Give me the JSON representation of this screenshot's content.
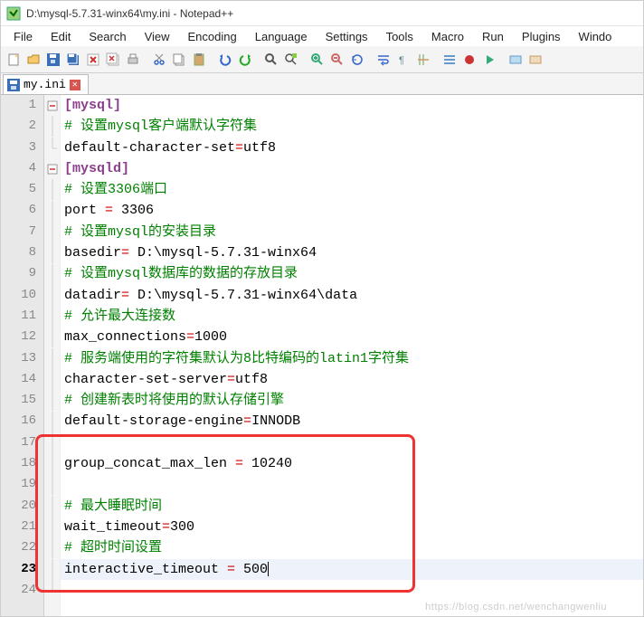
{
  "window": {
    "title": "D:\\mysql-5.7.31-winx64\\my.ini - Notepad++",
    "app": "Notepad++"
  },
  "menu": [
    "File",
    "Edit",
    "Search",
    "View",
    "Encoding",
    "Language",
    "Settings",
    "Tools",
    "Macro",
    "Run",
    "Plugins",
    "Windo"
  ],
  "tab": {
    "label": "my.ini"
  },
  "editor": {
    "active_line": 23,
    "lines": [
      {
        "n": 1,
        "fold": "minus",
        "seg": [
          {
            "c": "sect",
            "t": "[mysql]"
          }
        ]
      },
      {
        "n": 2,
        "fold": "pipe",
        "seg": [
          {
            "c": "cmt",
            "t": "# 设置mysql客户端默认字符集"
          }
        ]
      },
      {
        "n": 3,
        "fold": "end",
        "seg": [
          {
            "c": "kw",
            "t": "default-character-set"
          },
          {
            "c": "eq",
            "t": "="
          },
          {
            "c": "val",
            "t": "utf8"
          }
        ]
      },
      {
        "n": 4,
        "fold": "minus",
        "seg": [
          {
            "c": "sect",
            "t": "[mysqld]"
          }
        ]
      },
      {
        "n": 5,
        "fold": "pipe",
        "seg": [
          {
            "c": "cmt",
            "t": "# 设置3306端口"
          }
        ]
      },
      {
        "n": 6,
        "fold": "pipe",
        "seg": [
          {
            "c": "kw",
            "t": "port "
          },
          {
            "c": "eq",
            "t": "="
          },
          {
            "c": "val",
            "t": " 3306"
          }
        ]
      },
      {
        "n": 7,
        "fold": "pipe",
        "seg": [
          {
            "c": "cmt",
            "t": "# 设置mysql的安装目录"
          }
        ]
      },
      {
        "n": 8,
        "fold": "pipe",
        "seg": [
          {
            "c": "kw",
            "t": "basedir"
          },
          {
            "c": "eq",
            "t": "="
          },
          {
            "c": "val",
            "t": " D:\\\\mysql-5.7.31-winx64"
          }
        ]
      },
      {
        "n": 9,
        "fold": "pipe",
        "seg": [
          {
            "c": "cmt",
            "t": "# 设置mysql数据库的数据的存放目录"
          }
        ]
      },
      {
        "n": 10,
        "fold": "pipe",
        "seg": [
          {
            "c": "kw",
            "t": "datadir"
          },
          {
            "c": "eq",
            "t": "="
          },
          {
            "c": "val",
            "t": " D:\\\\mysql-5.7.31-winx64\\\\data"
          }
        ]
      },
      {
        "n": 11,
        "fold": "pipe",
        "seg": [
          {
            "c": "cmt",
            "t": "# 允许最大连接数"
          }
        ]
      },
      {
        "n": 12,
        "fold": "pipe",
        "seg": [
          {
            "c": "kw",
            "t": "max_connections"
          },
          {
            "c": "eq",
            "t": "="
          },
          {
            "c": "val",
            "t": "1000"
          }
        ]
      },
      {
        "n": 13,
        "fold": "pipe",
        "seg": [
          {
            "c": "cmt",
            "t": "# 服务端使用的字符集默认为8比特编码的latin1字符集"
          }
        ]
      },
      {
        "n": 14,
        "fold": "pipe",
        "seg": [
          {
            "c": "kw",
            "t": "character-set-server"
          },
          {
            "c": "eq",
            "t": "="
          },
          {
            "c": "val",
            "t": "utf8"
          }
        ]
      },
      {
        "n": 15,
        "fold": "pipe",
        "seg": [
          {
            "c": "cmt",
            "t": "# 创建新表时将使用的默认存储引擎"
          }
        ]
      },
      {
        "n": 16,
        "fold": "pipe",
        "seg": [
          {
            "c": "kw",
            "t": "default-storage-engine"
          },
          {
            "c": "eq",
            "t": "="
          },
          {
            "c": "val",
            "t": "INNODB"
          }
        ]
      },
      {
        "n": 17,
        "fold": "pipe",
        "seg": []
      },
      {
        "n": 18,
        "fold": "pipe",
        "seg": [
          {
            "c": "kw",
            "t": "group_concat_max_len "
          },
          {
            "c": "eq",
            "t": "="
          },
          {
            "c": "val",
            "t": " 10240"
          }
        ]
      },
      {
        "n": 19,
        "fold": "pipe",
        "seg": []
      },
      {
        "n": 20,
        "fold": "pipe",
        "seg": [
          {
            "c": "cmt",
            "t": "# 最大睡眠时间"
          }
        ]
      },
      {
        "n": 21,
        "fold": "pipe",
        "seg": [
          {
            "c": "kw",
            "t": "wait_timeout"
          },
          {
            "c": "eq",
            "t": "="
          },
          {
            "c": "val",
            "t": "300"
          }
        ]
      },
      {
        "n": 22,
        "fold": "pipe",
        "seg": [
          {
            "c": "cmt",
            "t": "# 超时时间设置"
          }
        ]
      },
      {
        "n": 23,
        "fold": "pipe",
        "seg": [
          {
            "c": "kw",
            "t": "interactive_timeout "
          },
          {
            "c": "eq",
            "t": "="
          },
          {
            "c": "val",
            "t": " 500"
          }
        ]
      },
      {
        "n": 24,
        "fold": "end",
        "seg": []
      }
    ]
  },
  "highlight_box": {
    "from_line": 17,
    "to_line": 23
  },
  "watermark": "https://blog.csdn.net/wenchangwenliu",
  "icons": {
    "toolbar": [
      "new",
      "open",
      "save",
      "save-all",
      "close",
      "close-all",
      "print",
      "",
      "cut",
      "copy",
      "paste",
      "",
      "undo",
      "redo",
      "",
      "find",
      "replace",
      "",
      "zoom-in",
      "zoom-out",
      "sync",
      "",
      "word-wrap",
      "show-all",
      "indent-guide",
      "",
      "fold",
      "record",
      "play",
      "",
      "toggle-1",
      "toggle-2"
    ]
  }
}
